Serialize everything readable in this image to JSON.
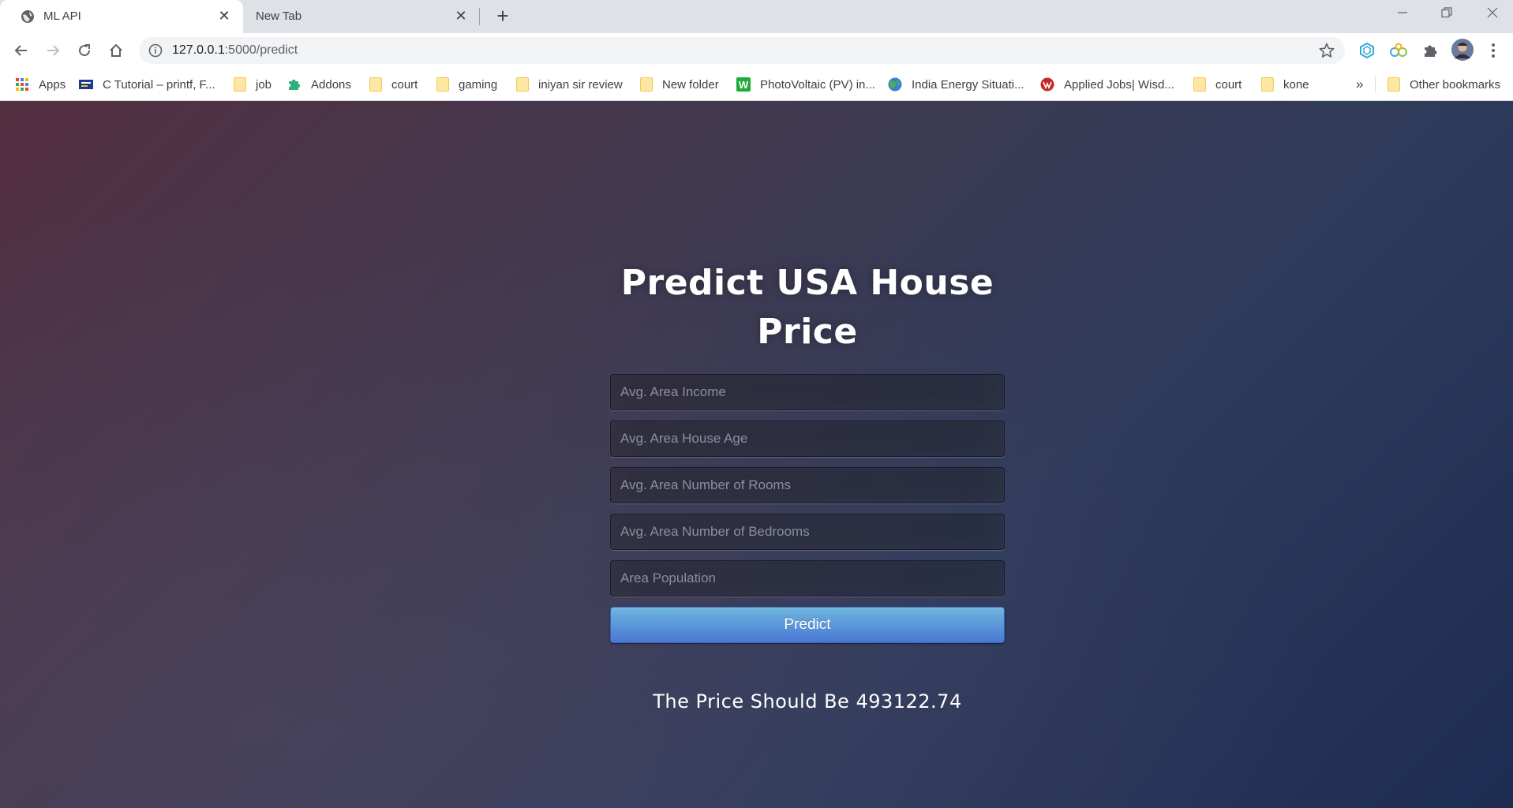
{
  "browser": {
    "tabs": [
      {
        "label": "ML API",
        "active": true
      },
      {
        "label": "New Tab",
        "active": false
      }
    ],
    "address": {
      "host": "127.0.0.1",
      "path": ":5000/predict"
    },
    "bookmarks": [
      {
        "label": "Apps",
        "icon": "apps-grid-icon"
      },
      {
        "label": "C Tutorial – printf, F...",
        "icon": "site-icon"
      },
      {
        "label": "job",
        "icon": "folder-icon"
      },
      {
        "label": "Addons",
        "icon": "puzzle-icon"
      },
      {
        "label": "court",
        "icon": "folder-icon"
      },
      {
        "label": "gaming",
        "icon": "folder-icon"
      },
      {
        "label": "iniyan sir review",
        "icon": "folder-icon"
      },
      {
        "label": "New folder",
        "icon": "folder-icon"
      },
      {
        "label": "PhotoVoltaic (PV) in...",
        "icon": "site-w-icon"
      },
      {
        "label": "India Energy Situati...",
        "icon": "globe-icon"
      },
      {
        "label": "Applied Jobs| Wisd...",
        "icon": "site-red-icon"
      },
      {
        "label": "court",
        "icon": "folder-icon"
      },
      {
        "label": "kone",
        "icon": "folder-icon"
      }
    ],
    "more_bookmarks": "»",
    "other_bookmarks": "Other bookmarks"
  },
  "page": {
    "title": "Predict USA House Price",
    "fields": [
      {
        "placeholder": "Avg. Area Income",
        "value": ""
      },
      {
        "placeholder": "Avg. Area House Age",
        "value": ""
      },
      {
        "placeholder": "Avg. Area Number of Rooms",
        "value": ""
      },
      {
        "placeholder": "Avg. Area Number of Bedrooms",
        "value": ""
      },
      {
        "placeholder": "Area Population",
        "value": ""
      }
    ],
    "button_label": "Predict",
    "result": "The Price Should Be 493122.74"
  },
  "colors": {
    "button_top": "#6eb6de",
    "button_bottom": "#4a77d4",
    "bg_dark_red": "#542f40",
    "bg_dark_blue": "#1d2c52"
  }
}
